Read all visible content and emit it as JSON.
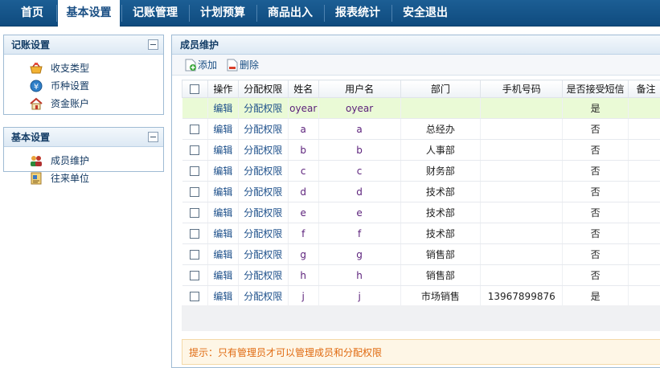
{
  "nav": {
    "items": [
      "首页",
      "基本设置",
      "记账管理",
      "计划预算",
      "商品出入",
      "报表统计",
      "安全退出"
    ],
    "active_index": 1
  },
  "sidebar": {
    "panels": [
      {
        "title": "记账设置",
        "items": [
          {
            "label": "收支类型",
            "icon": "basket-icon"
          },
          {
            "label": "币种设置",
            "icon": "yen-coin-icon"
          },
          {
            "label": "资金账户",
            "icon": "house-icon"
          }
        ]
      },
      {
        "title": "基本设置",
        "items": [
          {
            "label": "成员维护",
            "icon": "users-icon"
          },
          {
            "label": "往来单位",
            "icon": "address-book-icon"
          }
        ]
      }
    ]
  },
  "main": {
    "title": "成员维护",
    "toolbar": {
      "add": "添加",
      "delete": "删除"
    },
    "table": {
      "columns": [
        "",
        "操作",
        "分配权限",
        "姓名",
        "用户名",
        "部门",
        "手机号码",
        "是否接受短信",
        "备注"
      ],
      "rows": [
        {
          "checkbox": false,
          "edit": "编辑",
          "perm": "分配权限",
          "name": "oyear",
          "username": "oyear",
          "dept": "",
          "phone": "",
          "sms": "是",
          "note": "",
          "highlight": true
        },
        {
          "checkbox": true,
          "edit": "编辑",
          "perm": "分配权限",
          "name": "a",
          "username": "a",
          "dept": "总经办",
          "phone": "",
          "sms": "否",
          "note": ""
        },
        {
          "checkbox": true,
          "edit": "编辑",
          "perm": "分配权限",
          "name": "b",
          "username": "b",
          "dept": "人事部",
          "phone": "",
          "sms": "否",
          "note": ""
        },
        {
          "checkbox": true,
          "edit": "编辑",
          "perm": "分配权限",
          "name": "c",
          "username": "c",
          "dept": "财务部",
          "phone": "",
          "sms": "否",
          "note": ""
        },
        {
          "checkbox": true,
          "edit": "编辑",
          "perm": "分配权限",
          "name": "d",
          "username": "d",
          "dept": "技术部",
          "phone": "",
          "sms": "否",
          "note": ""
        },
        {
          "checkbox": true,
          "edit": "编辑",
          "perm": "分配权限",
          "name": "e",
          "username": "e",
          "dept": "技术部",
          "phone": "",
          "sms": "否",
          "note": ""
        },
        {
          "checkbox": true,
          "edit": "编辑",
          "perm": "分配权限",
          "name": "f",
          "username": "f",
          "dept": "技术部",
          "phone": "",
          "sms": "否",
          "note": ""
        },
        {
          "checkbox": true,
          "edit": "编辑",
          "perm": "分配权限",
          "name": "g",
          "username": "g",
          "dept": "销售部",
          "phone": "",
          "sms": "否",
          "note": ""
        },
        {
          "checkbox": true,
          "edit": "编辑",
          "perm": "分配权限",
          "name": "h",
          "username": "h",
          "dept": "销售部",
          "phone": "",
          "sms": "否",
          "note": ""
        },
        {
          "checkbox": true,
          "edit": "编辑",
          "perm": "分配权限",
          "name": "j",
          "username": "j",
          "dept": "市场销售",
          "phone": "13967899876",
          "sms": "是",
          "note": ""
        }
      ]
    },
    "tip": "提示：只有管理员才可以管理成员和分配权限"
  },
  "colors": {
    "nav_bg": "#0f4b7f",
    "highlight_row": "#eafad6",
    "tip_text": "#e06a10",
    "link": "#1c4f8a"
  }
}
